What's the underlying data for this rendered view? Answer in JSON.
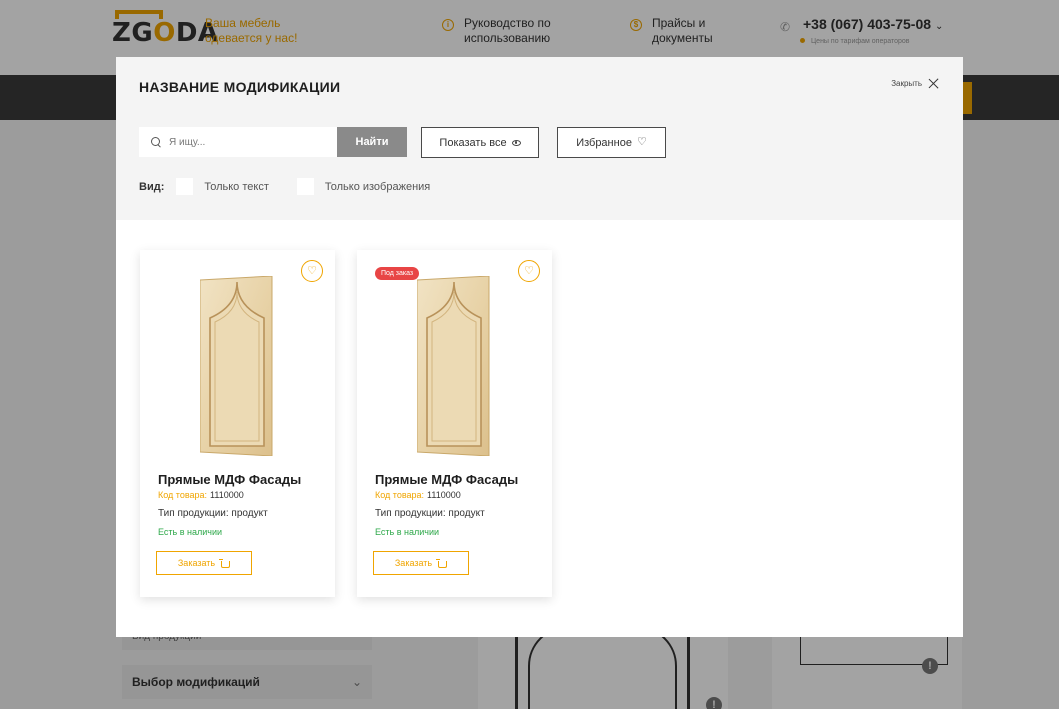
{
  "background_page": {
    "logo_text_left": "ZG",
    "logo_text_o": "O",
    "logo_text_right": "DA",
    "tagline": "Ваша мебель одевается у нас!",
    "guide_link": "Руководство по использованию",
    "pricelists_link": "Прайсы и документы",
    "phone": "+38 (067) 403-75-08",
    "phone_note": "Цены по тарифам операторов",
    "left_row_partial": "Вид продукции",
    "modifications_select": "Выбор модификаций"
  },
  "modal": {
    "title": "НАЗВАНИЕ МОДИФИКАЦИИ",
    "close_label": "Закрыть",
    "search": {
      "placeholder": "Я ищу...",
      "button_label": "Найти"
    },
    "show_all_label": "Показать все",
    "favorites_label": "Избранное",
    "view": {
      "label": "Вид:",
      "options": [
        "Только текст",
        "Только изображения"
      ]
    },
    "products": [
      {
        "name": "Прямые МДФ Фасады",
        "code_label": "Код товара:",
        "code": "1110000",
        "type": "Тип продукции: продукт",
        "stock": "Есть в наличии",
        "order_label": "Заказать",
        "badge": ""
      },
      {
        "name": "Прямые МДФ Фасады",
        "code_label": "Код товара:",
        "code": "1110000",
        "type": "Тип продукции: продукт",
        "stock": "Есть в наличии",
        "order_label": "Заказать",
        "badge": "Под заказ"
      }
    ]
  },
  "colors": {
    "accent": "#f0a500",
    "in_stock": "#2ea84a",
    "badge": "#e84545",
    "dark_nav": "#3a3a3a"
  }
}
